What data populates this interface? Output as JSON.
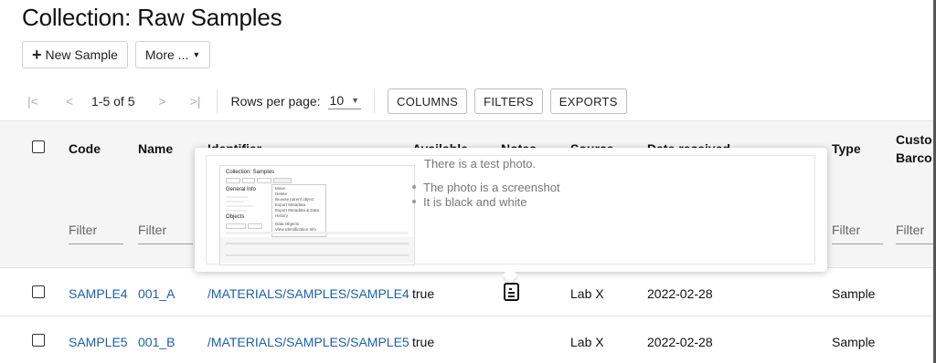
{
  "page": {
    "title": "Collection: Raw Samples"
  },
  "toolbar": {
    "new_sample_label": "New Sample",
    "more_label": "More ..."
  },
  "pager": {
    "first_icon": "|<",
    "prev_icon": "<",
    "range": "1-5 of 5",
    "next_icon": ">",
    "last_icon": ">|",
    "rows_per_page_label": "Rows per page:",
    "rows_per_page_value": "10",
    "columns_label": "COLUMNS",
    "filters_label": "FILTERS",
    "exports_label": "EXPORTS"
  },
  "table": {
    "columns": {
      "code": "Code",
      "name": "Name",
      "identifier": "Identifier",
      "available": "Available",
      "notes": "Notes",
      "source": "Source",
      "date_received": "Date received",
      "type": "Type",
      "custom_barcode_1": "Custo",
      "custom_barcode_2": "Barco"
    },
    "filter_placeholder": "Filter",
    "rows": [
      {
        "code": "SAMPLE4",
        "name": "001_A",
        "identifier": "/MATERIALS/SAMPLES/SAMPLE4",
        "available": "true",
        "source": "Lab X",
        "date_received": "2022-02-28",
        "type": "Sample"
      },
      {
        "code": "SAMPLE5",
        "name": "001_B",
        "identifier": "/MATERIALS/SAMPLES/SAMPLE5",
        "available": "true",
        "source": "Lab X",
        "date_received": "2022-02-28",
        "type": "Sample"
      }
    ]
  },
  "tooltip": {
    "heading": "There is a test photo.",
    "bullets": [
      "The photo is a screenshot",
      "It is black and white"
    ]
  },
  "thumbnail": {
    "title": "Collection: Samples",
    "section_general": "General Info",
    "section_objects": "Objects",
    "menu_items": [
      "Move",
      "Delete",
      "Browse parent object",
      "Export Metadata",
      "Export Metadata & Data",
      "History",
      "Data Objects",
      "View Identification Info"
    ]
  },
  "icons": {
    "notes": "document-icon"
  },
  "colors": {
    "link": "#1e5fae",
    "header_bg": "#f5f5f5"
  }
}
